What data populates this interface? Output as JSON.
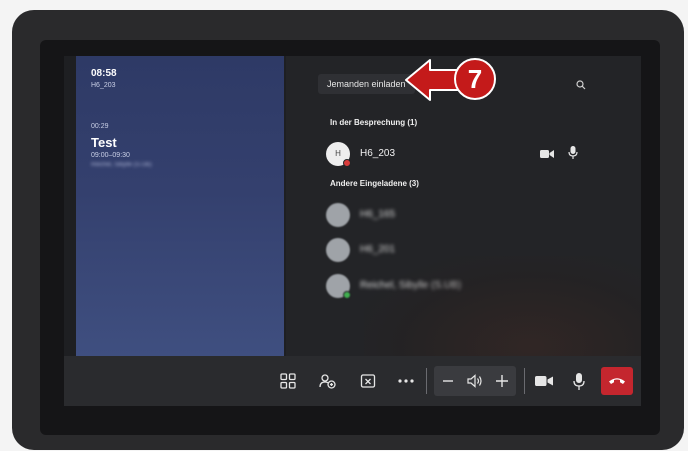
{
  "meeting": {
    "clock": "08:58",
    "room": "H6_203",
    "countdown": "00:29",
    "title": "Test",
    "time_range": "09:00–09:30",
    "organizer": "Reichel, Sibylle (S.UB)"
  },
  "people": {
    "invite_label": "Jemanden einladen",
    "in_meeting_heading": "In der Besprechung (1)",
    "in_meeting": [
      {
        "initial": "H",
        "name": "H6_203"
      }
    ],
    "invited_heading": "Andere Eingeladene (3)",
    "invited": [
      {
        "name": "H6_165"
      },
      {
        "name": "H6_201"
      },
      {
        "name": "Reichel, Sibylle (S.UB)"
      }
    ]
  },
  "controls": {
    "items": [
      "layout-icon",
      "share-icon",
      "stop-share-icon",
      "more-icon",
      "volume-down-icon",
      "speaker-icon",
      "volume-up-icon",
      "camera-icon",
      "microphone-icon",
      "hangup-icon"
    ]
  },
  "callout": {
    "number": "7"
  },
  "colors": {
    "hangup": "#c4262e",
    "callout": "#c41a1a",
    "presence_busy": "#d83b3b",
    "presence_available": "#3fae4f",
    "presence_away": "#e2b63a"
  }
}
